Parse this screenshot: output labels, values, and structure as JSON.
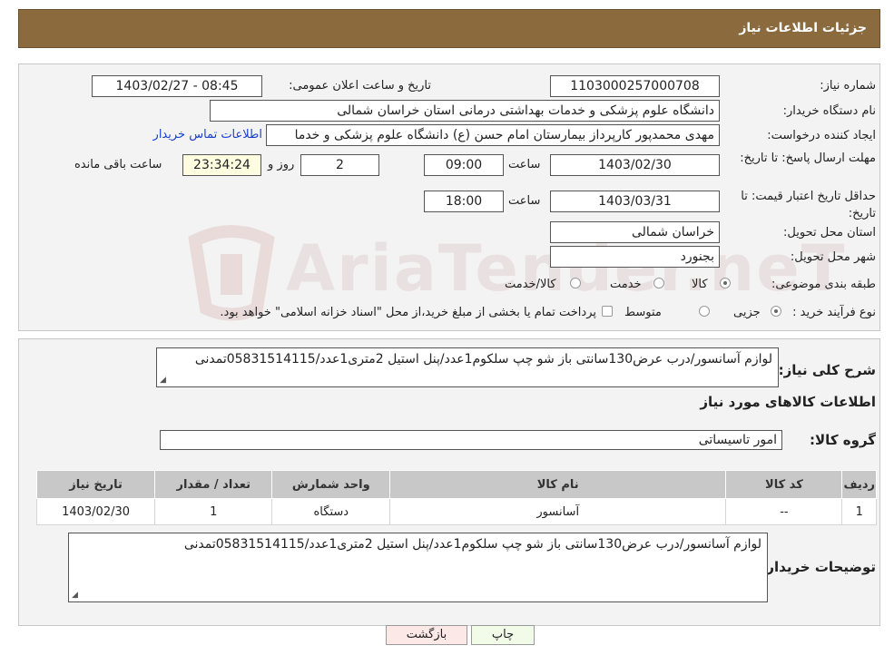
{
  "header": {
    "title": "جزئیات اطلاعات نیاز"
  },
  "info": {
    "need_no_label": "شماره نیاز:",
    "need_no": "1103000257000708",
    "announce_label": "تاریخ و ساعت اعلان عمومی:",
    "announce_value": "1403/02/27 - 08:45",
    "buyer_org_label": "نام دستگاه خریدار:",
    "buyer_org": "دانشگاه علوم پزشکی و خدمات بهداشتی درمانی استان خراسان شمالی",
    "requester_label": "ایجاد کننده درخواست:",
    "requester": "مهدی محمدپور کارپرداز بیمارستان امام حسن (ع) دانشگاه علوم پزشکی و خدما",
    "contact_link": "اطلاعات تماس خریدار",
    "deadline_label": "مهلت ارسال پاسخ: تا تاریخ:",
    "deadline_date": "1403/02/30",
    "time_label": "ساعت",
    "deadline_time": "09:00",
    "days_value": "2",
    "days_label": "روز و",
    "remaining_value": "23:34:24",
    "remaining_label": "ساعت باقی مانده",
    "validity_label": "حداقل تاریخ اعتبار قیمت: تا تاریخ:",
    "validity_date": "1403/03/31",
    "validity_time_label": "ساعت",
    "validity_time": "18:00",
    "province_label": "استان محل تحویل:",
    "province": "خراسان شمالی",
    "city_label": "شهر محل تحویل:",
    "city": "بجنورد",
    "category_label": "طبقه بندی موضوعی:",
    "category_options": [
      "کالا",
      "خدمت",
      "کالا/خدمت"
    ],
    "process_label": "نوع فرآیند خرید :",
    "process_options": [
      "جزیی",
      "متوسط"
    ],
    "process_note": "پرداخت تمام یا بخشی از مبلغ خرید،از محل \"اسناد خزانه اسلامی\" خواهد بود."
  },
  "summary": {
    "label": "شرح کلی نیاز:",
    "text": "لوازم آسانسور/درب عرض130سانتی باز شو چپ سلکوم1عدد/پنل استیل 2متری1عدد/05831514115تمدنی",
    "goods_heading": "اطلاعات کالاهای مورد نیاز",
    "group_label": "گروه کالا:",
    "group_value": "امور تاسیساتی"
  },
  "table": {
    "headers": [
      "ردیف",
      "کد کالا",
      "نام کالا",
      "واحد شمارش",
      "تعداد / مقدار",
      "تاریخ نیاز"
    ],
    "rows": [
      [
        "1",
        "--",
        "آسانسور",
        "دستگاه",
        "1",
        "1403/02/30"
      ]
    ]
  },
  "buyer_notes": {
    "label": "توضیحات خریدار:",
    "text": "لوازم آسانسور/درب عرض130سانتی باز شو چپ سلکوم1عدد/پنل استیل 2متری1عدد/05831514115تمدنی"
  },
  "buttons": {
    "print": "چاپ",
    "back": "بازگشت"
  },
  "watermark": "AriaTender.neT"
}
